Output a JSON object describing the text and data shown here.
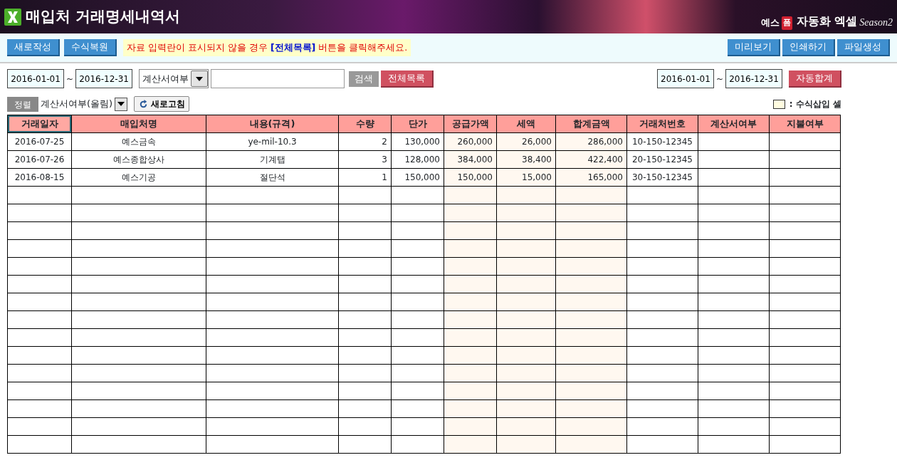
{
  "window": {
    "title": "매입처 거래명세내역서"
  },
  "brand": {
    "prefix": "예스",
    "badge": "폼",
    "name": "자동화 엑셀",
    "edition": "Season2"
  },
  "toolbar": {
    "left_buttons": [
      "새로작성",
      "수식복원"
    ],
    "notice": "자료 입력란이 표시되지  않을 경우 **[전체목록]** 버튼을 클릭해주세요.",
    "right_buttons": [
      "미리보기",
      "인쇄하기",
      "파일생성"
    ]
  },
  "filter": {
    "date_from": "2016-01-01",
    "separator": "~",
    "date_to": "2016-12-31",
    "field_select": "계산서여부",
    "search_button": "검색",
    "list_all_button": "전체목록"
  },
  "summary": {
    "date_from": "2016-01-01",
    "separator": "~",
    "date_to": "2016-12-31",
    "button": "자동합계"
  },
  "sort": {
    "label": "정렬",
    "select": "계산서여부(올림)",
    "refresh_button": "새로고침"
  },
  "legend": {
    "label": ": 수식삽입 셀"
  },
  "table": {
    "columns": [
      {
        "label": "거래일자",
        "kind": "text",
        "formula": false,
        "selected": true
      },
      {
        "label": "매입처명",
        "kind": "text",
        "formula": false,
        "selected": false
      },
      {
        "label": "내용(규격)",
        "kind": "text",
        "formula": false,
        "selected": false
      },
      {
        "label": "수량",
        "kind": "number",
        "formula": false,
        "selected": false
      },
      {
        "label": "단가",
        "kind": "number",
        "formula": false,
        "selected": false
      },
      {
        "label": "공급가액",
        "kind": "number",
        "formula": true,
        "selected": false
      },
      {
        "label": "세액",
        "kind": "number",
        "formula": true,
        "selected": false
      },
      {
        "label": "합계금액",
        "kind": "number",
        "formula": true,
        "selected": false
      },
      {
        "label": "거래처번호",
        "kind": "text",
        "formula": false,
        "selected": false
      },
      {
        "label": "계산서여부",
        "kind": "text",
        "formula": false,
        "selected": false
      },
      {
        "label": "지불여부",
        "kind": "text",
        "formula": false,
        "selected": false
      }
    ],
    "rows": [
      [
        "2016-07-25",
        "예스금속",
        "ye-mil-10.3",
        "2",
        "130,000",
        "260,000",
        "26,000",
        "286,000",
        "10-150-12345",
        null,
        null
      ],
      [
        "2016-07-26",
        "예스종합상사",
        "기계탭",
        "3",
        "128,000",
        "384,000",
        "38,400",
        "422,400",
        "20-150-12345",
        null,
        null
      ],
      [
        "2016-08-15",
        "예스기공",
        "절단석",
        "1",
        "150,000",
        "150,000",
        "15,000",
        "165,000",
        "30-150-12345",
        null,
        null
      ]
    ]
  }
}
